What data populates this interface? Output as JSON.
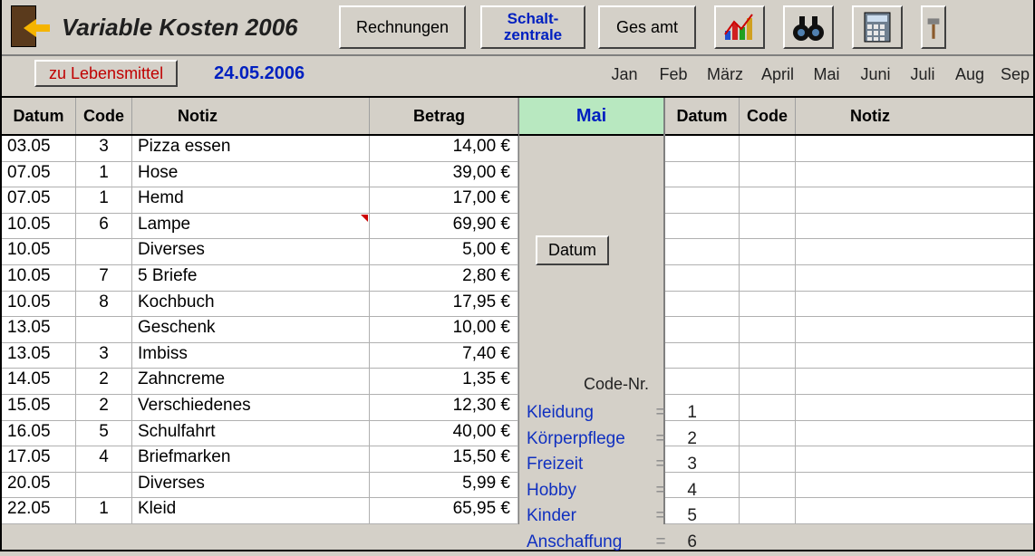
{
  "header": {
    "title": "Variable Kosten  2006",
    "rechnungen": "Rechnungen",
    "schalt1": "Schalt-",
    "schalt2": "zentrale",
    "gesamt": "Ges amt"
  },
  "sub": {
    "lebensmittel": "zu Lebensmittel",
    "date": "24.05.2006"
  },
  "months": [
    "Jan",
    "Feb",
    "März",
    "April",
    "Mai",
    "Juni",
    "Juli",
    "Aug",
    "Sep"
  ],
  "month_widths": [
    54,
    54,
    60,
    56,
    52,
    56,
    48,
    56,
    44
  ],
  "cols": {
    "datum": "Datum",
    "code": "Code",
    "notiz": "Notiz",
    "betrag": "Betrag",
    "mai": "Mai"
  },
  "rows": [
    {
      "datum": "03.05",
      "code": "3",
      "notiz": "Pizza essen",
      "betrag": "14,00 €",
      "mark": false
    },
    {
      "datum": "07.05",
      "code": "1",
      "notiz": "Hose",
      "betrag": "39,00 €",
      "mark": false
    },
    {
      "datum": "07.05",
      "code": "1",
      "notiz": "Hemd",
      "betrag": "17,00 €",
      "mark": false
    },
    {
      "datum": "10.05",
      "code": "6",
      "notiz": "Lampe",
      "betrag": "69,90 €",
      "mark": true
    },
    {
      "datum": "10.05",
      "code": "",
      "notiz": "Diverses",
      "betrag": "5,00 €",
      "mark": false
    },
    {
      "datum": "10.05",
      "code": "7",
      "notiz": "5 Briefe",
      "betrag": "2,80 €",
      "mark": false
    },
    {
      "datum": "10.05",
      "code": "8",
      "notiz": "Kochbuch",
      "betrag": "17,95 €",
      "mark": false
    },
    {
      "datum": "13.05",
      "code": "",
      "notiz": "Geschenk",
      "betrag": "10,00 €",
      "mark": false
    },
    {
      "datum": "13.05",
      "code": "3",
      "notiz": "Imbiss",
      "betrag": "7,40 €",
      "mark": false
    },
    {
      "datum": "14.05",
      "code": "2",
      "notiz": "Zahncreme",
      "betrag": "1,35 €",
      "mark": false
    },
    {
      "datum": "15.05",
      "code": "2",
      "notiz": "Verschiedenes",
      "betrag": "12,30 €",
      "mark": false
    },
    {
      "datum": "16.05",
      "code": "5",
      "notiz": "Schulfahrt",
      "betrag": "40,00 €",
      "mark": false
    },
    {
      "datum": "17.05",
      "code": "4",
      "notiz": "Briefmarken",
      "betrag": "15,50 €",
      "mark": false
    },
    {
      "datum": "20.05",
      "code": "",
      "notiz": "Diverses",
      "betrag": "5,99 €",
      "mark": false
    },
    {
      "datum": "22.05",
      "code": "1",
      "notiz": "Kleid",
      "betrag": "65,95 €",
      "mark": false
    }
  ],
  "mid": {
    "datum_btn": "Datum",
    "codenr": "Code-Nr.",
    "codes": [
      {
        "name": "Kleidung",
        "num": "1"
      },
      {
        "name": "Körperpflege",
        "num": "2"
      },
      {
        "name": "Freizeit",
        "num": "3"
      },
      {
        "name": "Hobby",
        "num": "4"
      },
      {
        "name": "Kinder",
        "num": "5"
      },
      {
        "name": "Anschaffung",
        "num": "6"
      }
    ]
  }
}
